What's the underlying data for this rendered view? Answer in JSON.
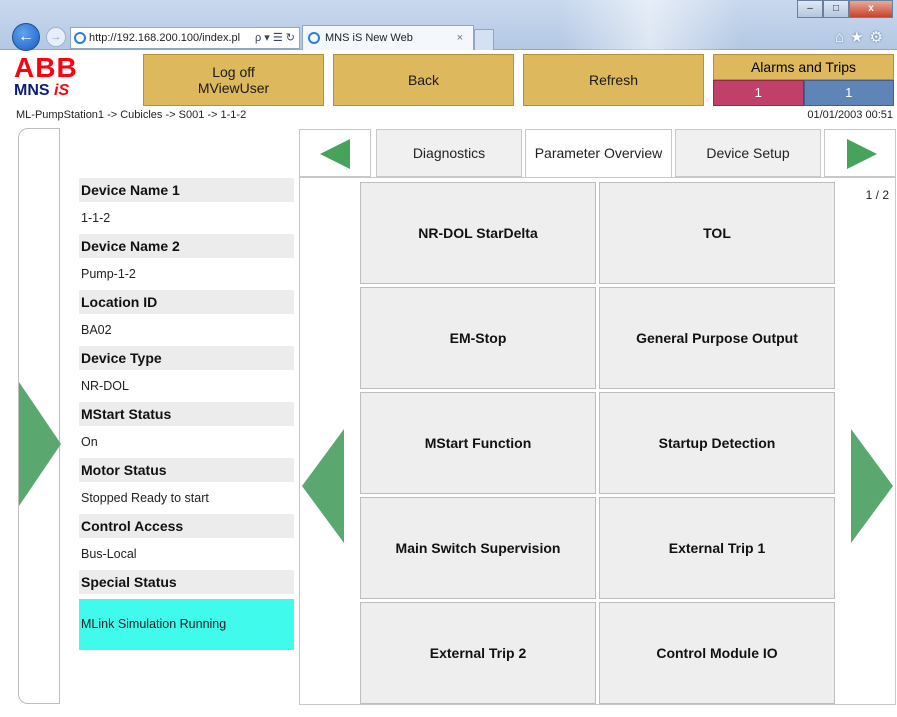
{
  "browser": {
    "address_url": "http://192.168.200.100/index.pl",
    "address_tools": "ρ ▾ ☰ ↻",
    "tab_title": "MNS iS New Web",
    "tab_close": "×",
    "window_buttons": [
      "–",
      "□",
      "x"
    ],
    "toolbar_icons": "⌂★⚙"
  },
  "logo": {
    "brand": "ABB",
    "product_prefix": "MNS ",
    "product_suffix": "iS"
  },
  "header": {
    "logoff_line1": "Log off",
    "logoff_line2": "MViewUser",
    "back_label": "Back",
    "refresh_label": "Refresh",
    "alarms_label": "Alarms and Trips",
    "alarms_count": "1",
    "trips_count": "1"
  },
  "breadcrumb": "ML-PumpStation1 -> Cubicles -> S001 -> 1-1-2",
  "datetime": "01/01/2003 00:51",
  "info": {
    "device_name_1_label": "Device Name 1",
    "device_name_1_value": "1-1-2",
    "device_name_2_label": "Device Name 2",
    "device_name_2_value": "Pump-1-2",
    "location_id_label": "Location ID",
    "location_id_value": "BA02",
    "device_type_label": "Device Type",
    "device_type_value": "NR-DOL",
    "mstart_status_label": "MStart Status",
    "mstart_status_value": "On",
    "motor_status_label": "Motor Status",
    "motor_status_value": "Stopped Ready to start",
    "control_access_label": "Control Access",
    "control_access_value": "Bus-Local",
    "special_status_label": "Special Status",
    "special_status_value": "MLink Simulation Running"
  },
  "tabs": {
    "diagnostics": "Diagnostics",
    "parameter_overview": "Parameter Overview",
    "device_setup": "Device Setup"
  },
  "page_indicator": "1 / 2",
  "parameters": [
    "NR-DOL StarDelta",
    "TOL",
    "EM-Stop",
    "General Purpose Output",
    "MStart Function",
    "Startup Detection",
    "Main Switch Supervision",
    "External Trip 1",
    "External Trip 2",
    "Control Module IO"
  ],
  "colors": {
    "header_button": "#ddb85c",
    "alarm_red": "#c0406a",
    "alarm_blue": "#5f84b8",
    "arrow_green": "#5aa870",
    "special_status_bg": "#40fbec"
  }
}
